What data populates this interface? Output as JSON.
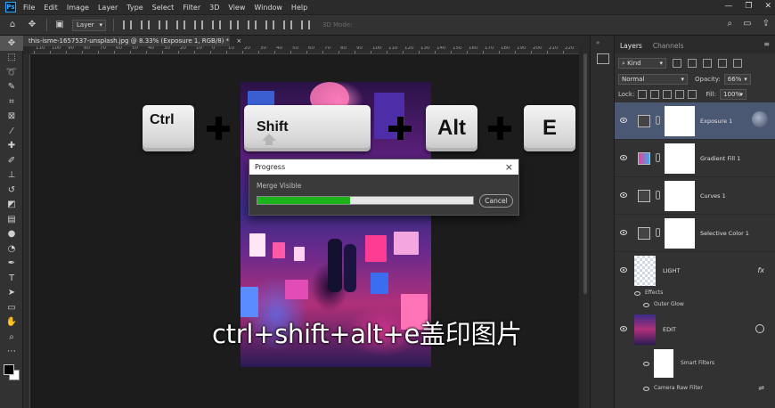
{
  "app": {
    "logo": "Ps",
    "menu": [
      "File",
      "Edit",
      "Image",
      "Layer",
      "Type",
      "Select",
      "Filter",
      "3D",
      "View",
      "Window",
      "Help"
    ]
  },
  "options_bar": {
    "auto_select_target": "Layer",
    "mode_3d_label": "3D Mode:"
  },
  "document": {
    "tab_title": "this-isme-1657537-unsplash.jpg @ 8.33% (Exposure 1, RGB/8) *",
    "tab_close": "×",
    "ruler_labels": [
      "110",
      "100",
      "90",
      "80",
      "70",
      "60",
      "50",
      "40",
      "30",
      "20",
      "10",
      "0",
      "10",
      "20",
      "30",
      "40",
      "50",
      "60",
      "70",
      "80",
      "90",
      "100",
      "110",
      "120",
      "130",
      "140",
      "150",
      "160",
      "170",
      "180",
      "190",
      "200",
      "210",
      "220"
    ]
  },
  "keys": {
    "ctrl": "Ctrl",
    "shift": "Shift",
    "alt": "Alt",
    "e": "E"
  },
  "dialog": {
    "title": "Progress",
    "close": "×",
    "status": "Merge Visible",
    "progress_fraction": 0.43,
    "cancel_label": "Cancel"
  },
  "caption": "ctrl+shift+alt+e盖印图片",
  "layers_panel": {
    "tabs": [
      "Layers",
      "Channels"
    ],
    "kind_label": "Kind",
    "blend_mode": "Normal",
    "opacity_label": "Opacity:",
    "opacity_value": "66%",
    "lock_label": "Lock:",
    "fill_label": "Fill:",
    "fill_value": "100%",
    "layers": [
      {
        "name": "Exposure 1",
        "selected": true
      },
      {
        "name": "Gradient Fill 1",
        "selected": false
      },
      {
        "name": "Curves 1",
        "selected": false
      },
      {
        "name": "Selective Color 1",
        "selected": false
      },
      {
        "name": "LIGHT",
        "selected": false,
        "fx": "fx"
      },
      {
        "name": "EDIT",
        "selected": false
      }
    ],
    "effects_label": "Effects",
    "outer_glow_label": "Outer Glow",
    "smart_filters_label": "Smart Filters",
    "camera_raw_label": "Camera Raw Filter"
  },
  "colors": {
    "accent_selected_layer": "#4b5874",
    "progress_green": "#1bb41b",
    "ps_blue": "#31a8ff"
  }
}
